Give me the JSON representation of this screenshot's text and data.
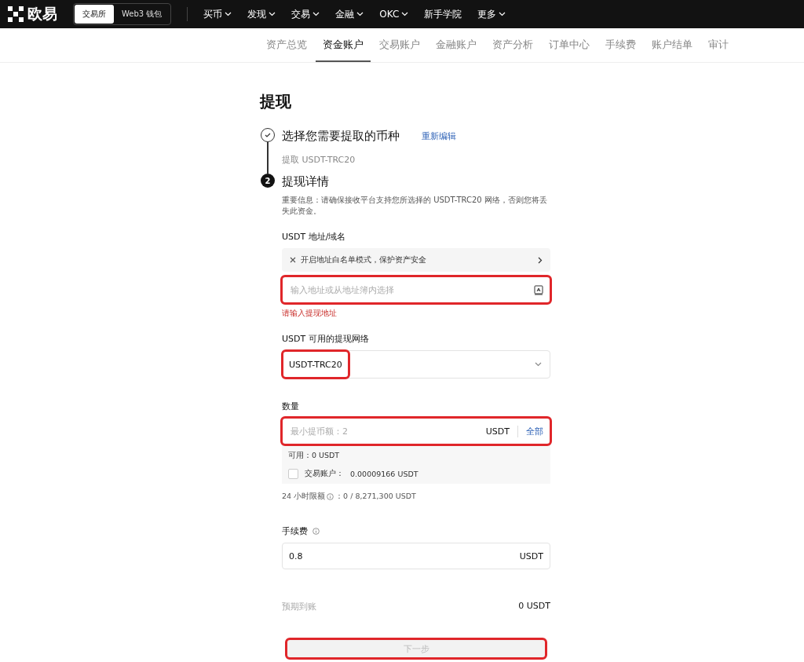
{
  "brand": {
    "name": "欧易"
  },
  "mode_switch": [
    {
      "label": "交易所",
      "selected": true
    },
    {
      "label": "Web3 钱包",
      "selected": false
    }
  ],
  "top_nav": [
    {
      "label": "买币",
      "dropdown": true
    },
    {
      "label": "发现",
      "dropdown": true
    },
    {
      "label": "交易",
      "dropdown": true
    },
    {
      "label": "金融",
      "dropdown": true
    },
    {
      "label": "OKC",
      "dropdown": true
    },
    {
      "label": "新手学院",
      "dropdown": false
    },
    {
      "label": "更多",
      "dropdown": true
    }
  ],
  "tabs": [
    {
      "label": "资产总览",
      "selected": false
    },
    {
      "label": "资金账户",
      "selected": true
    },
    {
      "label": "交易账户",
      "selected": false
    },
    {
      "label": "金融账户",
      "selected": false
    },
    {
      "label": "资产分析",
      "selected": false
    },
    {
      "label": "订单中心",
      "selected": false
    },
    {
      "label": "手续费",
      "selected": false
    },
    {
      "label": "账户结单",
      "selected": false
    },
    {
      "label": "审计",
      "selected": false
    }
  ],
  "page_title": "提现",
  "steps": [
    {
      "done": true,
      "title": "选择您需要提取的币种",
      "action": "重新编辑",
      "summary": "提取 USDT-TRC20"
    },
    {
      "number": "2",
      "done": false,
      "title": "提现详情",
      "notice": "重要信息：请确保接收平台支持您所选择的 USDT-TRC20 网络，否则您将丢失此资金。"
    }
  ],
  "address": {
    "label": "USDT 地址/域名",
    "banner": "开启地址白名单模式，保护资产安全",
    "placeholder": "输入地址或从地址簿内选择",
    "error": "请输入提现地址",
    "highlighted": true
  },
  "network": {
    "label": "USDT 可用的提现网络",
    "value": "USDT-TRC20",
    "highlighted": true
  },
  "amount": {
    "label": "数量",
    "placeholder": "最小提币额：2",
    "unit": "USDT",
    "all": "全部",
    "highlighted": true,
    "available": "可用：0 USDT",
    "transfer_label": "交易账户：",
    "transfer_value": "0.00009166 USDT",
    "transfer_checked": false,
    "limit": "24 小时限额",
    "limit_value": "：0 / 8,271,300 USDT"
  },
  "fee": {
    "label": "手续费",
    "value": "0.8",
    "unit": "USDT"
  },
  "receive": {
    "label": "预期到账",
    "value": "0 USDT"
  },
  "next": {
    "label": "下一步",
    "disabled": true,
    "highlighted": true
  }
}
